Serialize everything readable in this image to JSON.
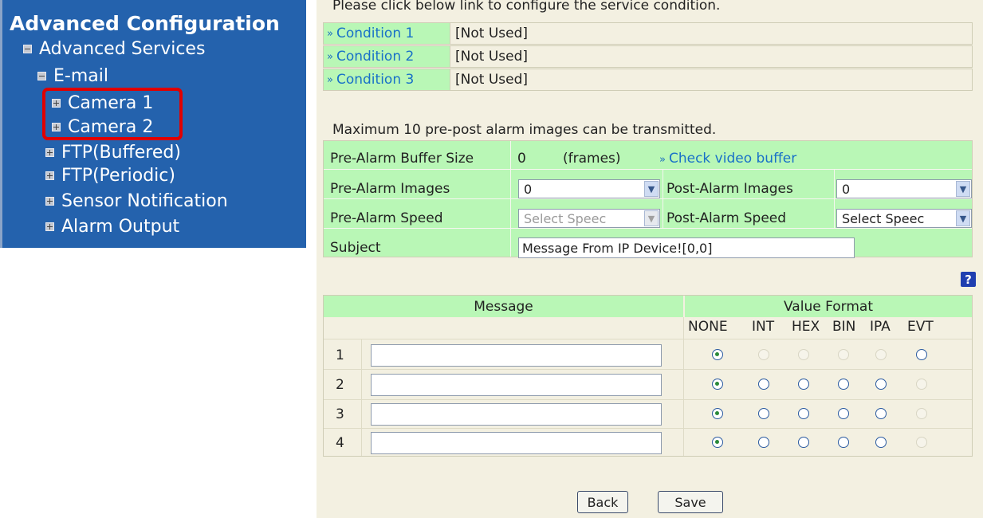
{
  "sidebar": {
    "title": "Advanced Configuration",
    "items": [
      {
        "label": "Advanced Services",
        "state": "expanded"
      },
      {
        "label": "E-mail",
        "state": "expanded"
      },
      {
        "label": "Camera 1",
        "state": "collapsed"
      },
      {
        "label": "Camera 2",
        "state": "collapsed"
      },
      {
        "label": "FTP(Buffered)",
        "state": "collapsed"
      },
      {
        "label": "FTP(Periodic)",
        "state": "collapsed"
      },
      {
        "label": "Sensor Notification",
        "state": "collapsed"
      },
      {
        "label": "Alarm Output",
        "state": "collapsed"
      }
    ],
    "highlight_color": "#e00000"
  },
  "conditions": {
    "intro": "Please click below link to configure the service condition.",
    "items": [
      {
        "label": "Condition 1",
        "value": "[Not Used]"
      },
      {
        "label": "Condition 2",
        "value": "[Not Used]"
      },
      {
        "label": "Condition 3",
        "value": "[Not Used]"
      }
    ]
  },
  "alarm": {
    "note": "Maximum 10 pre-post alarm images can be transmitted.",
    "buffer_label": "Pre-Alarm Buffer Size",
    "buffer_value": "0",
    "buffer_unit": "(frames)",
    "check_link": "Check video buffer",
    "pre_images_label": "Pre-Alarm Images",
    "pre_images_value": "0",
    "post_images_label": "Post-Alarm Images",
    "post_images_value": "0",
    "pre_speed_label": "Pre-Alarm Speed",
    "pre_speed_value": "Select Speec",
    "post_speed_label": "Post-Alarm Speed",
    "post_speed_value": "Select Speec",
    "subject_label": "Subject",
    "subject_value": "Message From IP Device![0,0]"
  },
  "help_icon": "?",
  "message_table": {
    "message_header": "Message",
    "format_header": "Value Format",
    "formats": [
      "NONE",
      "INT",
      "HEX",
      "BIN",
      "IPA",
      "EVT"
    ],
    "rows": [
      {
        "num": "1",
        "text": "",
        "selected": "NONE",
        "enabled": [
          true,
          false,
          false,
          false,
          false,
          true
        ]
      },
      {
        "num": "2",
        "text": "",
        "selected": "NONE",
        "enabled": [
          true,
          true,
          true,
          true,
          true,
          false
        ]
      },
      {
        "num": "3",
        "text": "",
        "selected": "NONE",
        "enabled": [
          true,
          true,
          true,
          true,
          true,
          false
        ]
      },
      {
        "num": "4",
        "text": "",
        "selected": "NONE",
        "enabled": [
          true,
          true,
          true,
          true,
          true,
          false
        ]
      }
    ]
  },
  "buttons": {
    "back": "Back",
    "save": "Save"
  },
  "colors": {
    "sidebar_bg": "#2462ad",
    "panel_bg": "#f3f0e1",
    "green": "#b9f7b6",
    "link": "#1870c8"
  }
}
